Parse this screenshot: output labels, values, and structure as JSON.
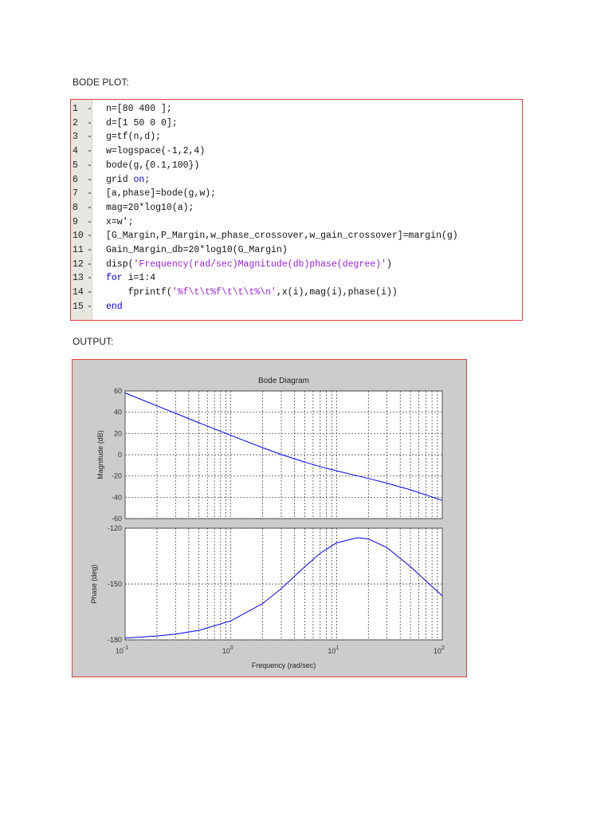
{
  "headings": {
    "code": "BODE PLOT:",
    "output": "OUTPUT:"
  },
  "code_lines": [
    {
      "n": "1",
      "text": "n=[80 400 ];"
    },
    {
      "n": "2",
      "text": "d=[1 50 0 0];"
    },
    {
      "n": "3",
      "text": "g=tf(n,d);"
    },
    {
      "n": "4",
      "text": "w=logspace(-1,2,4)"
    },
    {
      "n": "5",
      "text": "bode(g,{0.1,100})"
    },
    {
      "n": "6",
      "pre": "grid ",
      "kw": "on",
      "post": ";"
    },
    {
      "n": "7",
      "text": "[a,phase]=bode(g,w);"
    },
    {
      "n": "8",
      "text": "mag=20*log10(a);"
    },
    {
      "n": "9",
      "text": "x=w';"
    },
    {
      "n": "10",
      "text": "[G_Margin,P_Margin,w_phase_crossover,w_gain_crossover]=margin(g)"
    },
    {
      "n": "11",
      "text": "Gain_Margin_db=20*log10(G_Margin)"
    },
    {
      "n": "12",
      "pre": "disp(",
      "str": "'Frequency(rad/sec)Magnitude(db)phase(degree)'",
      "post": ")"
    },
    {
      "n": "13",
      "kw": "for",
      "post": " i=1:4"
    },
    {
      "n": "14",
      "pre": "    fprintf(",
      "str": "'%f\\t\\t%f\\t\\t\\t%\\n'",
      "post": ",x(i),mag(i),phase(i))"
    },
    {
      "n": "15",
      "kw": "end"
    }
  ],
  "chart_data": [
    {
      "type": "line",
      "title": "Bode Diagram",
      "xlabel": "Frequency  (rad/sec)",
      "ylabel": "Magnitude (dB)",
      "xscale": "log",
      "xlim": [
        0.1,
        100
      ],
      "ylim": [
        -60,
        60
      ],
      "yticks": [
        60,
        40,
        20,
        0,
        -20,
        -40,
        -60
      ],
      "xticks": [
        "10^-1",
        "10^0",
        "10^1",
        "10^2"
      ],
      "grid": true,
      "color": "#0000ff",
      "x": [
        0.1,
        0.2,
        0.3,
        0.5,
        1,
        2,
        3,
        5,
        7,
        10,
        20,
        30,
        50,
        100
      ],
      "y": [
        58.1,
        46.0,
        39.0,
        30.1,
        18.2,
        6.7,
        0.3,
        -6.9,
        -11.1,
        -15.1,
        -22.3,
        -26.7,
        -32.9,
        -42.9
      ]
    },
    {
      "type": "line",
      "xlabel": "Frequency  (rad/sec)",
      "ylabel": "Phase (deg)",
      "xscale": "log",
      "xlim": [
        0.1,
        100
      ],
      "ylim": [
        -180,
        -120
      ],
      "yticks": [
        -120,
        -150,
        -180
      ],
      "grid": true,
      "color": "#0000ff",
      "x": [
        0.1,
        0.2,
        0.3,
        0.5,
        1,
        2,
        3,
        5,
        7,
        10,
        15.8,
        20,
        30,
        50,
        100
      ],
      "y": [
        -179.0,
        -177.9,
        -176.9,
        -174.9,
        -169.8,
        -160.5,
        -152.5,
        -140.7,
        -133.5,
        -127.9,
        -125.1,
        -125.8,
        -130.4,
        -140.7,
        -156.3
      ]
    }
  ]
}
